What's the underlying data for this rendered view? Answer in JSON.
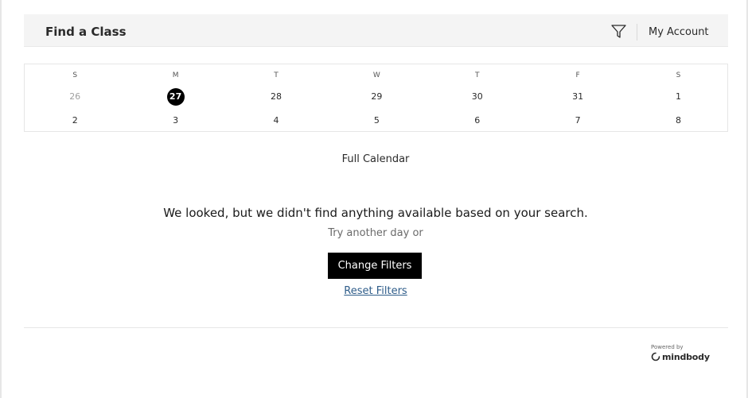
{
  "header": {
    "title": "Find a Class",
    "filter_icon": "filter-funnel-icon",
    "account_label": "My Account"
  },
  "calendar": {
    "weekdays": [
      "S",
      "M",
      "T",
      "W",
      "T",
      "F",
      "S"
    ],
    "weeks": [
      [
        {
          "label": "26",
          "state": "muted"
        },
        {
          "label": "27",
          "state": "selected"
        },
        {
          "label": "28",
          "state": "normal"
        },
        {
          "label": "29",
          "state": "normal"
        },
        {
          "label": "30",
          "state": "normal"
        },
        {
          "label": "31",
          "state": "normal"
        },
        {
          "label": "1",
          "state": "normal"
        }
      ],
      [
        {
          "label": "2",
          "state": "normal"
        },
        {
          "label": "3",
          "state": "normal"
        },
        {
          "label": "4",
          "state": "normal"
        },
        {
          "label": "5",
          "state": "normal"
        },
        {
          "label": "6",
          "state": "normal"
        },
        {
          "label": "7",
          "state": "normal"
        },
        {
          "label": "8",
          "state": "normal"
        }
      ]
    ],
    "full_calendar_label": "Full Calendar"
  },
  "empty_state": {
    "message": "We looked, but we didn't find anything available based on your search.",
    "suggestion": "Try another day or",
    "change_filters_label": "Change Filters",
    "reset_filters_label": "Reset Filters"
  },
  "footer": {
    "powered_by": "Powered by",
    "brand": "mindbody",
    "brand_icon": "mindbody-logo-icon"
  },
  "colors": {
    "header_bg": "#f4f4f4",
    "accent": "#000000",
    "link": "#2f5d8a",
    "muted_text": "#a0a0a0"
  }
}
